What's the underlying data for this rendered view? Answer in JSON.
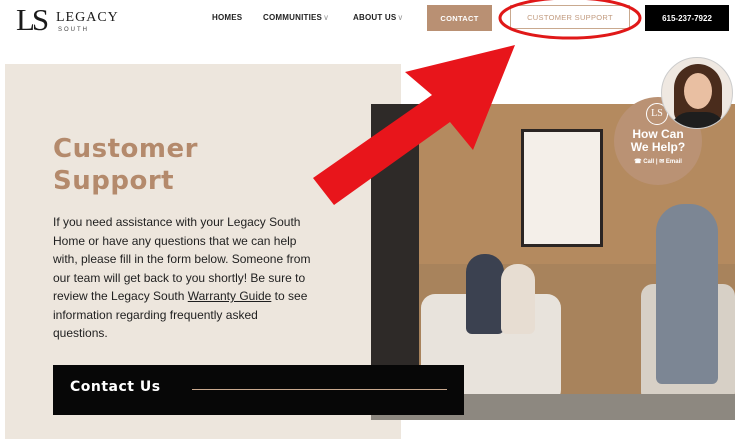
{
  "brand": {
    "mark": "LS",
    "name": "LEGACY",
    "sub": "SOUTH"
  },
  "nav": {
    "homes": "HOMES",
    "communities": "COMMUNITIES",
    "about": "ABOUT US",
    "chevron": "∨"
  },
  "buttons": {
    "contact": "CONTACT",
    "support": "CUSTOMER SUPPORT",
    "phone": "615-237-7922"
  },
  "hero": {
    "title_line1": "Customer",
    "title_line2": "Support",
    "body_before_link": "If you need assistance with your Legacy South Home or have any questions that we can help with, please fill in the form below. Someone from our team will get back to you shortly!  Be sure to review the Legacy South ",
    "link": "Warranty Guide",
    "body_after_link": " to see information regarding frequently asked questions.",
    "contact_us": "Contact Us"
  },
  "help_widget": {
    "logo": "LS",
    "title_line1": "How Can",
    "title_line2": "We Help?",
    "links": "☎ Call | ✉ Email"
  },
  "colors": {
    "accent": "#b99073",
    "panel": "#ede6dd",
    "annotation": "#e01818"
  }
}
